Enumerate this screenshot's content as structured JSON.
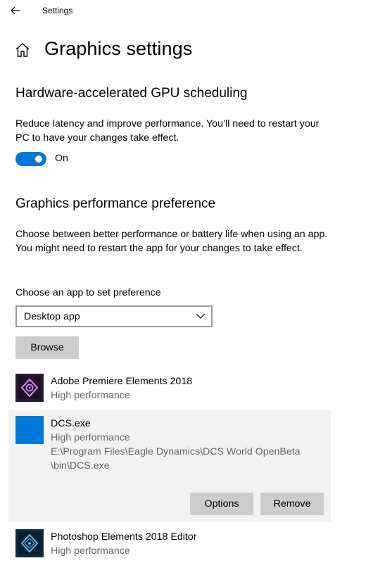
{
  "titlebar": {
    "app_title": "Settings",
    "back_icon": "back-arrow-icon"
  },
  "page": {
    "title": "Graphics settings",
    "home_icon": "home-icon"
  },
  "gpu_scheduling": {
    "heading": "Hardware-accelerated GPU scheduling",
    "description": "Reduce latency and improve performance. You’ll need to restart your PC to have your changes take effect.",
    "toggle_state": "On",
    "toggle_on": true
  },
  "performance_pref": {
    "heading": "Graphics performance preference",
    "description": "Choose between better performance or battery life when using an app. You might need to restart the app for your changes to take effect.",
    "choose_label": "Choose an app to set preference",
    "app_type_selected": "Desktop app",
    "browse_label": "Browse"
  },
  "apps": [
    {
      "name": "Adobe Premiere Elements 2018",
      "preference": "High performance",
      "icon": "premiere-elements-icon"
    },
    {
      "name": "DCS.exe",
      "preference": "High performance",
      "path_line1": "E:\\Program Files\\Eagle Dynamics\\DCS World OpenBeta",
      "path_line2": "\\bin\\DCS.exe",
      "icon": "dcs-app-icon",
      "options_label": "Options",
      "remove_label": "Remove"
    },
    {
      "name": "Photoshop Elements 2018 Editor",
      "preference": "High performance",
      "icon": "photoshop-elements-icon"
    }
  ],
  "colors": {
    "accent": "#0078d7",
    "button_bg": "#cccccc",
    "selected_bg": "#f2f2f2",
    "secondary_text": "#666666"
  }
}
